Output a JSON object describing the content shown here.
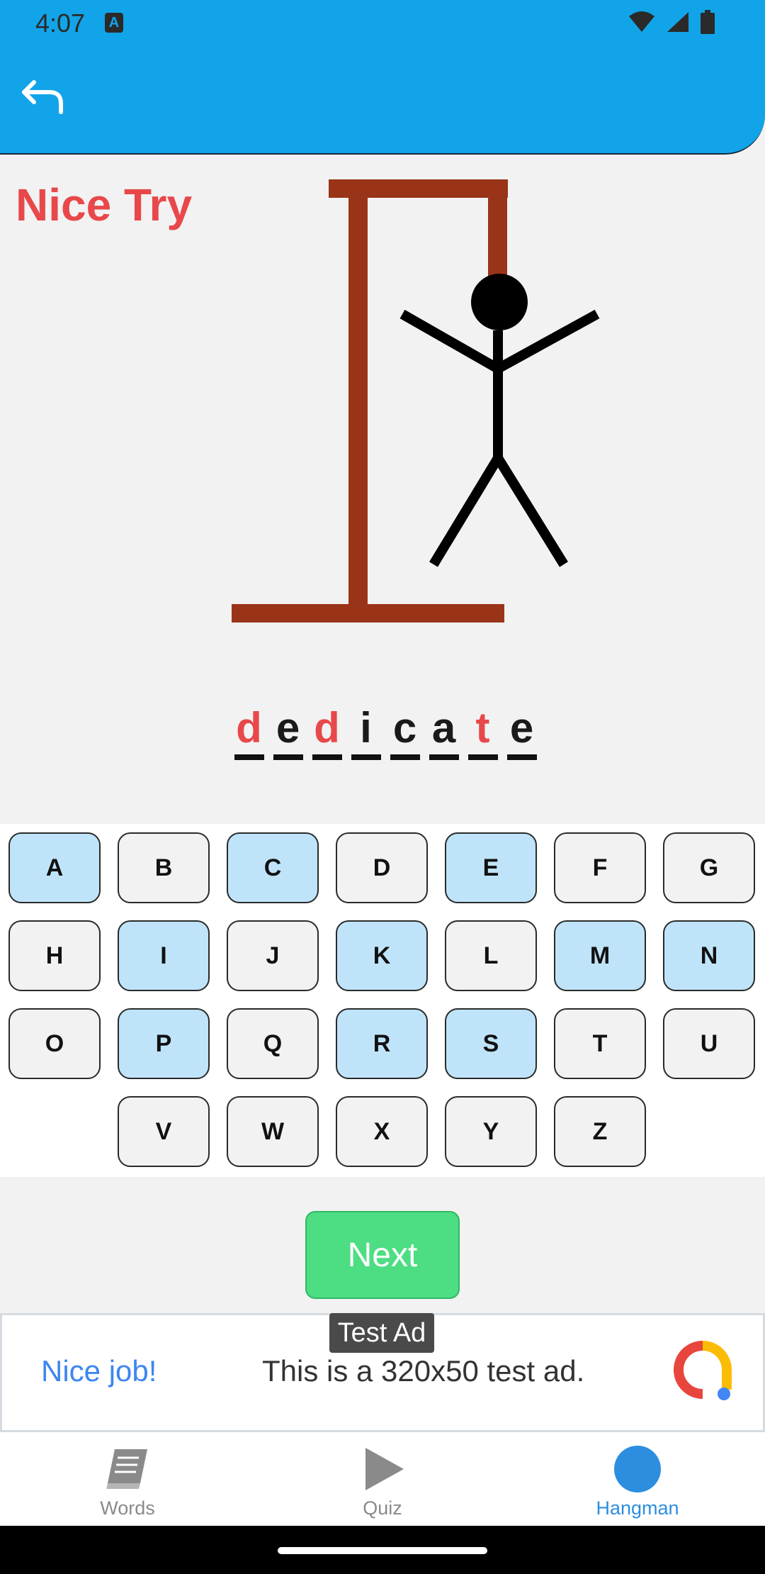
{
  "status_bar": {
    "time": "4:07",
    "app_icon_letter": "A"
  },
  "app_bar": {
    "back_icon": "undo-arrow-icon",
    "color": "#12a4e8"
  },
  "game": {
    "result_text": "Nice Try",
    "result_color": "#e8484a",
    "word": [
      {
        "letter": "d",
        "state": "missed"
      },
      {
        "letter": "e",
        "state": "guessed"
      },
      {
        "letter": "d",
        "state": "missed"
      },
      {
        "letter": "i",
        "state": "guessed"
      },
      {
        "letter": "c",
        "state": "guessed"
      },
      {
        "letter": "a",
        "state": "guessed"
      },
      {
        "letter": "t",
        "state": "missed"
      },
      {
        "letter": "e",
        "state": "guessed"
      }
    ]
  },
  "keyboard": {
    "rows": [
      [
        "A",
        "B",
        "C",
        "D",
        "E",
        "F",
        "G"
      ],
      [
        "H",
        "I",
        "J",
        "K",
        "L",
        "M",
        "N"
      ],
      [
        "O",
        "P",
        "Q",
        "R",
        "S",
        "T",
        "U"
      ],
      [
        "V",
        "W",
        "X",
        "Y",
        "Z"
      ]
    ],
    "used_letters": [
      "A",
      "C",
      "E",
      "I",
      "K",
      "M",
      "N",
      "P",
      "R",
      "S"
    ],
    "used_color": "#bfe4fa"
  },
  "next_button": {
    "label": "Next"
  },
  "ad": {
    "badge": "Test Ad",
    "headline": "Nice job!",
    "body": "This is a 320x50 test ad."
  },
  "bottom_nav": {
    "items": [
      {
        "label": "Words",
        "icon": "book-icon",
        "active": false
      },
      {
        "label": "Quiz",
        "icon": "play-icon",
        "active": false
      },
      {
        "label": "Hangman",
        "icon": "circle-icon",
        "active": true
      }
    ]
  }
}
